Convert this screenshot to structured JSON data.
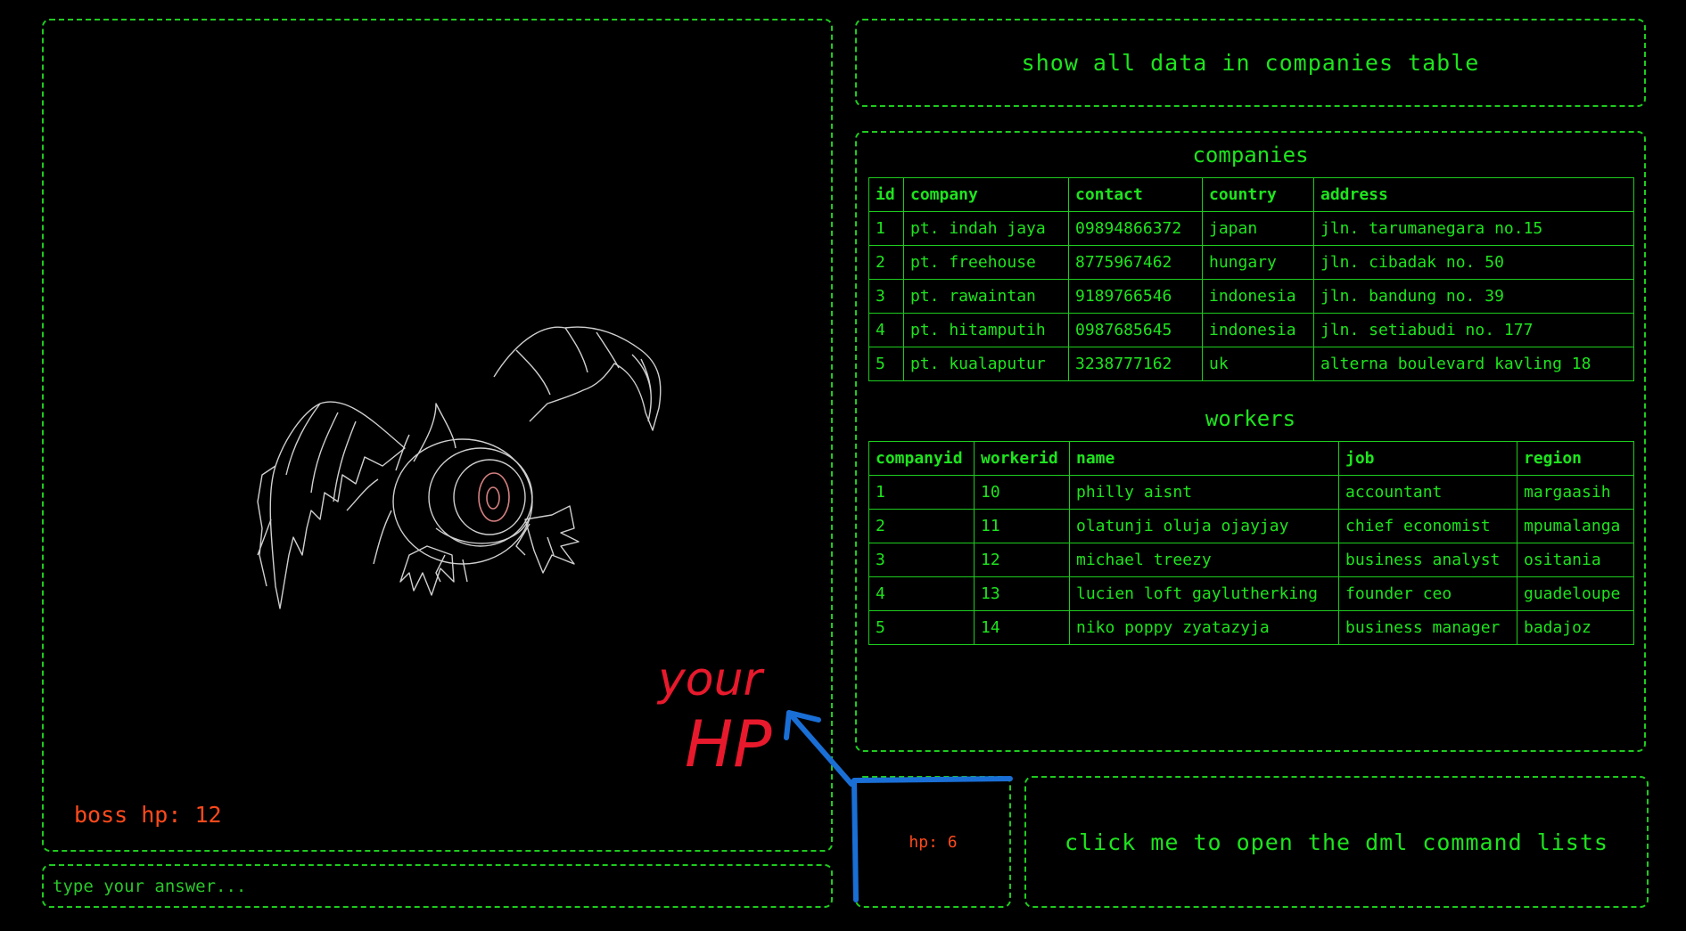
{
  "boss": {
    "hp_label": "boss hp: 12"
  },
  "answer": {
    "placeholder": "type your answer..."
  },
  "question": {
    "text": "show all data in companies table"
  },
  "companies": {
    "title": "companies",
    "headers": [
      "id",
      "company",
      "contact",
      "country",
      "address"
    ],
    "rows": [
      [
        "1",
        "pt. indah jaya",
        "09894866372",
        "japan",
        "jln. tarumanegara no.15"
      ],
      [
        "2",
        "pt. freehouse",
        "8775967462",
        "hungary",
        "jln. cibadak no. 50"
      ],
      [
        "3",
        "pt. rawaintan",
        "9189766546",
        "indonesia",
        "jln. bandung no. 39"
      ],
      [
        "4",
        "pt. hitamputih",
        "0987685645",
        "indonesia",
        "jln. setiabudi no. 177"
      ],
      [
        "5",
        "pt. kualaputur",
        "3238777162",
        "uk",
        "alterna boulevard kavling 18"
      ]
    ]
  },
  "workers": {
    "title": "workers",
    "headers": [
      "companyid",
      "workerid",
      "name",
      "job",
      "region"
    ],
    "rows": [
      [
        "1",
        "10",
        "philly aisnt",
        "accountant",
        "margaasih"
      ],
      [
        "2",
        "11",
        "olatunji oluja ojayjay",
        "chief economist",
        "mpumalanga"
      ],
      [
        "3",
        "12",
        "michael treezy",
        "business analyst",
        "ositania"
      ],
      [
        "4",
        "13",
        "lucien loft gaylutherking",
        "founder ceo",
        "guadeloupe"
      ],
      [
        "5",
        "14",
        "niko poppy zyatazyja",
        "business manager",
        "badajoz"
      ]
    ]
  },
  "player": {
    "hp_label": "hp: 6"
  },
  "dml": {
    "button_label": "click me to open the dml command lists"
  },
  "annotation": {
    "text_line1": "your",
    "text_line2": "HP"
  },
  "colors": {
    "terminal_green": "#1ee41e",
    "hp_orange": "#ff4a1c",
    "annotation_red": "#e8192c",
    "annotation_blue": "#1a6fd6"
  }
}
